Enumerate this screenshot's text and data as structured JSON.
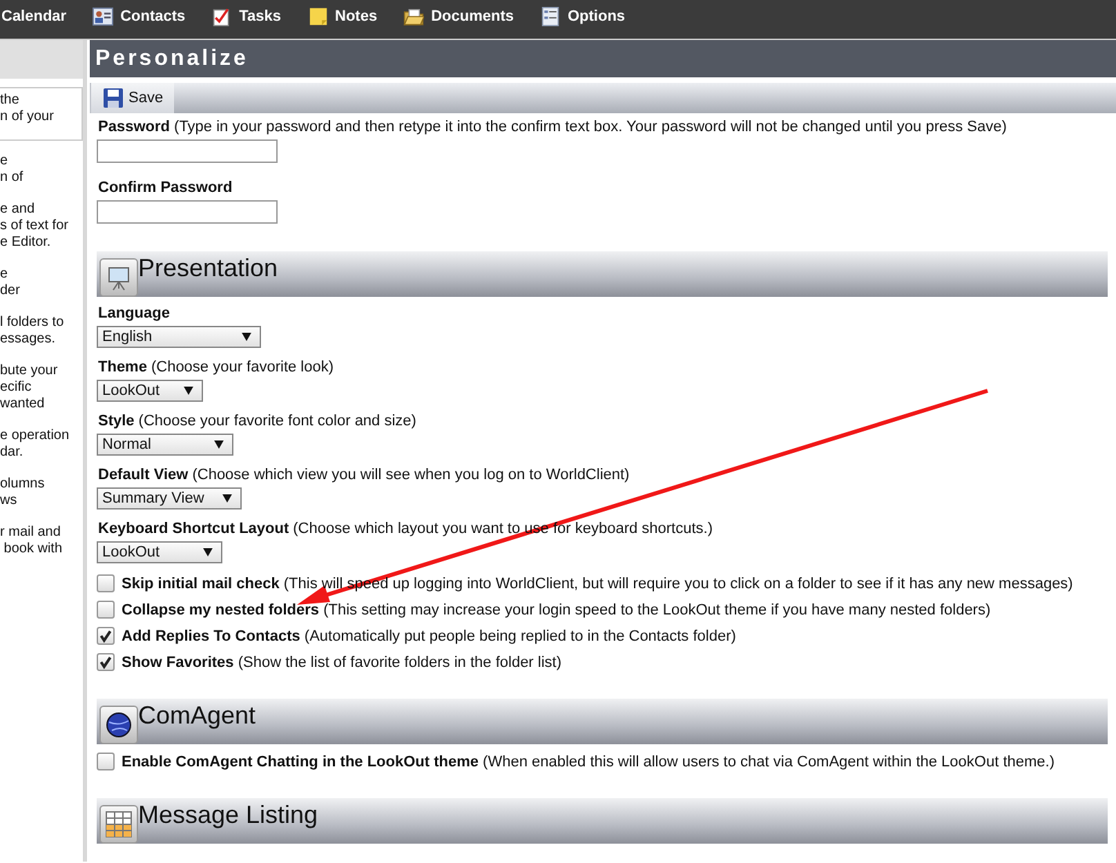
{
  "nav": [
    {
      "label": "Calendar",
      "kind": "calendar"
    },
    {
      "label": "Contacts",
      "kind": "contacts"
    },
    {
      "label": "Tasks",
      "kind": "tasks"
    },
    {
      "label": "Notes",
      "kind": "notes"
    },
    {
      "label": "Documents",
      "kind": "documents"
    },
    {
      "label": "Options",
      "kind": "options"
    }
  ],
  "sidebar": {
    "items": [
      {
        "text": "the\nn of your",
        "selected": true
      },
      {
        "text": "e\nn of",
        "selected": false
      },
      {
        "text": "e and\ns of text for\ne Editor.",
        "selected": false
      },
      {
        "text": "e\nder",
        "selected": false
      },
      {
        "text": "l folders to\nessages.",
        "selected": false
      },
      {
        "text": "bute your\necific\nwanted",
        "selected": false
      },
      {
        "text": "e operation\ndar.",
        "selected": false
      },
      {
        "text": "olumns\nws",
        "selected": false
      },
      {
        "text": "r mail and\n book with",
        "selected": false
      }
    ]
  },
  "page": {
    "title": "Personalize",
    "toolbar": {
      "save": "Save"
    }
  },
  "password": {
    "label": "Password",
    "hint": "(Type in your password and then retype it into the confirm text box. Your password will not be changed until you press Save)",
    "confirm_label": "Confirm Password"
  },
  "sections": [
    {
      "title": "Presentation",
      "kind": "easel",
      "selects": [
        {
          "label": "Language",
          "value": "English"
        },
        {
          "label": "Theme",
          "hint": "(Choose your favorite look)",
          "value": "LookOut"
        },
        {
          "label": "Style",
          "hint": "(Choose your favorite font color and size)",
          "value": "Normal"
        },
        {
          "label": "Default View",
          "hint": "(Choose which view you will see when you log on to WorldClient)",
          "value": "Summary View"
        },
        {
          "label": "Keyboard Shortcut Layout",
          "hint": "(Choose which layout you want to use for keyboard shortcuts.)",
          "value": "LookOut"
        }
      ],
      "options": [
        {
          "label": "Skip initial mail check",
          "hint": "(This will speed up logging into WorldClient, but will require you to click on a folder to see if it has any new messages)",
          "checked": false
        },
        {
          "label": "Collapse my nested folders",
          "hint": "(This setting may increase your login speed to the LookOut theme if you have many nested folders)",
          "checked": false
        },
        {
          "label": "Add Replies To Contacts",
          "hint": "(Automatically put people being replied to in the Contacts folder)",
          "checked": true
        },
        {
          "label": "Show Favorites",
          "hint": "(Show the list of favorite folders in the folder list)",
          "checked": true
        }
      ]
    },
    {
      "title": "ComAgent",
      "kind": "globe",
      "options": [
        {
          "label": "Enable ComAgent Chatting in the LookOut theme",
          "hint": "(When enabled this will allow users to chat via ComAgent within the LookOut theme.)",
          "checked": false
        }
      ]
    },
    {
      "title": "Message Listing",
      "kind": "grid"
    }
  ]
}
